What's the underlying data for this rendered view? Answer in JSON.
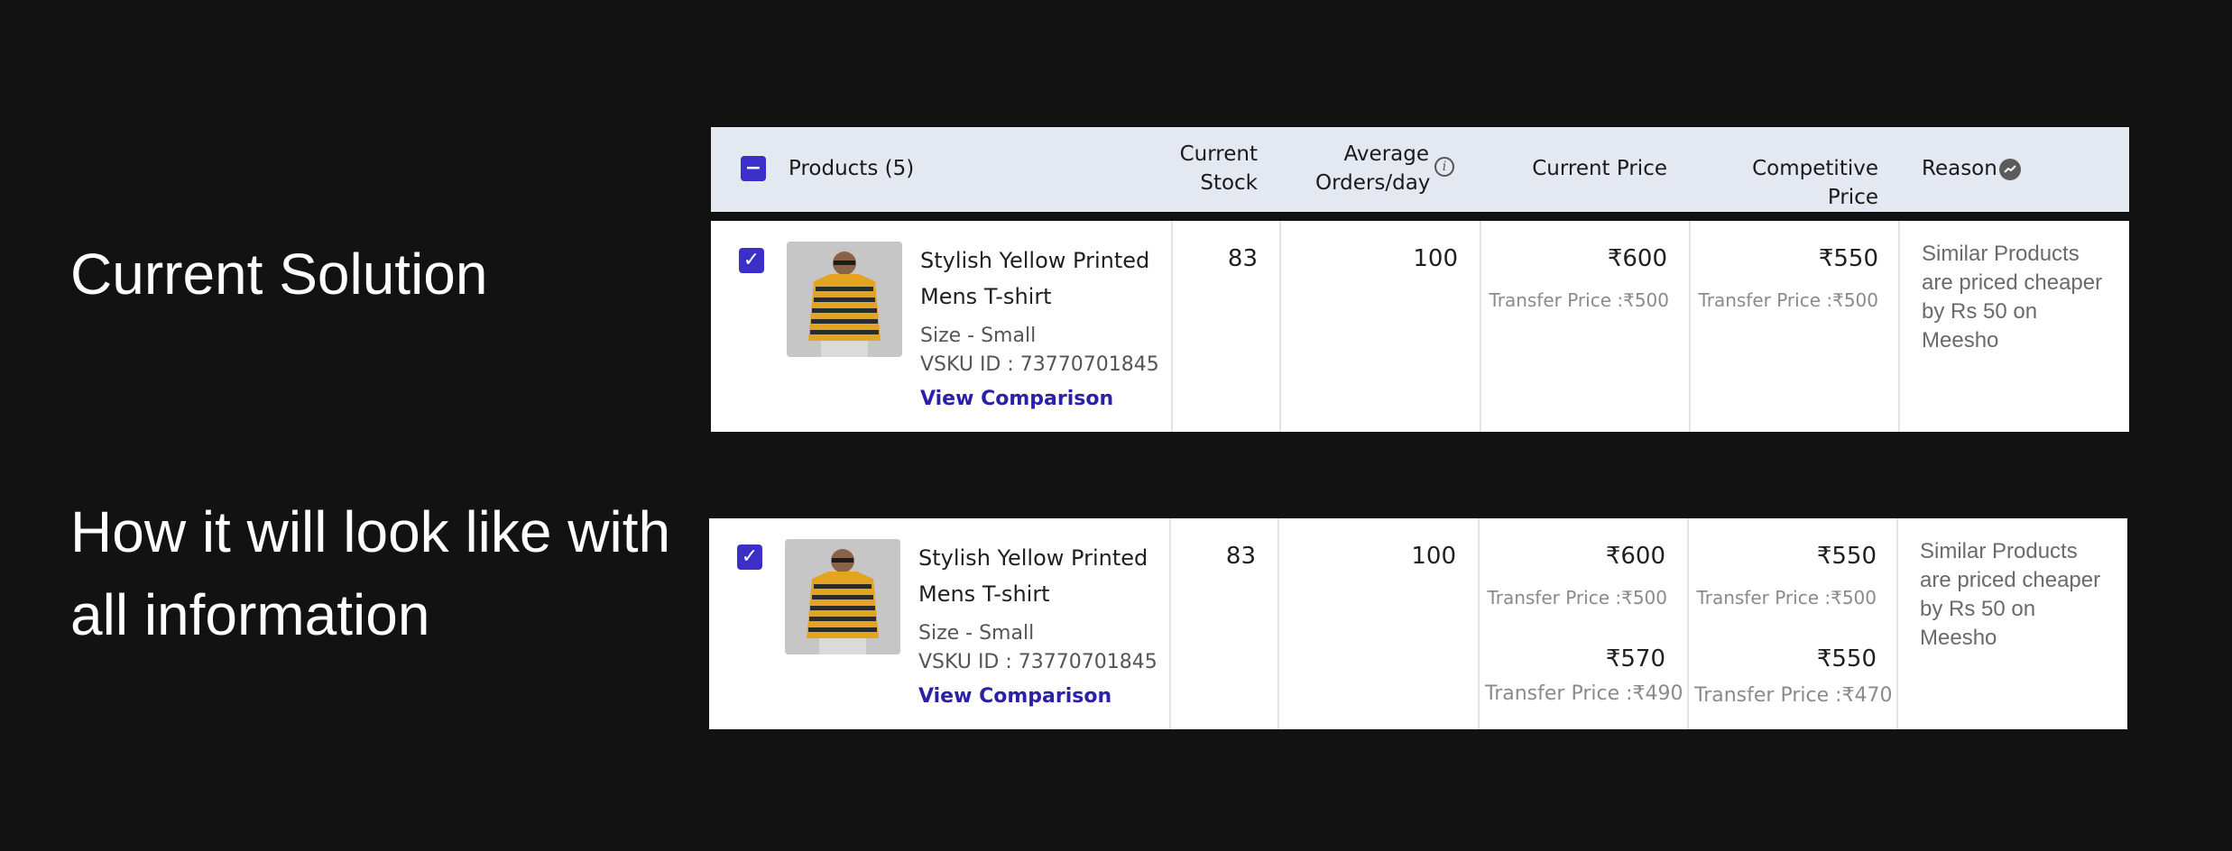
{
  "labels": {
    "current": "Current Solution",
    "future": "How it will look like with all information"
  },
  "table": {
    "headers": {
      "products": "Products (5)",
      "current_stock": "Current Stock",
      "average_orders": "Average Orders/day",
      "current_price": "Current Price",
      "competitive_price": "Competitive Price",
      "reason": "Reason"
    },
    "select_all_state": "indeterminate"
  },
  "rows": [
    {
      "checked": true,
      "name": "Stylish Yellow Printed Mens T-shirt",
      "size": "Size - Small",
      "vsku": "VSKU ID : 73770701845",
      "link": "View Comparison",
      "stock": "83",
      "orders": "100",
      "current_price": "₹600",
      "current_transfer": "Transfer Price :₹500",
      "competitive_price": "₹550",
      "competitive_transfer": "Transfer Price :₹500",
      "reason": "Similar Products are priced cheaper by Rs 50 on Meesho"
    },
    {
      "checked": true,
      "name": "Stylish Yellow Printed Mens T-shirt",
      "size": "Size - Small",
      "vsku": "VSKU ID : 73770701845",
      "link": "View Comparison",
      "stock": "83",
      "orders": "100",
      "current_price": "₹600",
      "current_transfer": "Transfer Price :₹500",
      "current_price_2": "₹570",
      "current_transfer_2": "Transfer Price :₹490",
      "competitive_price": "₹550",
      "competitive_transfer": "Transfer Price :₹500",
      "competitive_price_2": "₹550",
      "competitive_transfer_2": "Transfer Price :₹470",
      "reason": "Similar Products are priced cheaper by Rs 50 on Meesho"
    }
  ],
  "colors": {
    "background": "#121212",
    "header_bg": "#e4e8f1",
    "accent": "#3b2fc7",
    "link": "#2b21a8"
  },
  "icons": {
    "select_all": "minus-icon",
    "row_check": "check-icon",
    "info": "info-icon",
    "trend": "trend-icon"
  }
}
